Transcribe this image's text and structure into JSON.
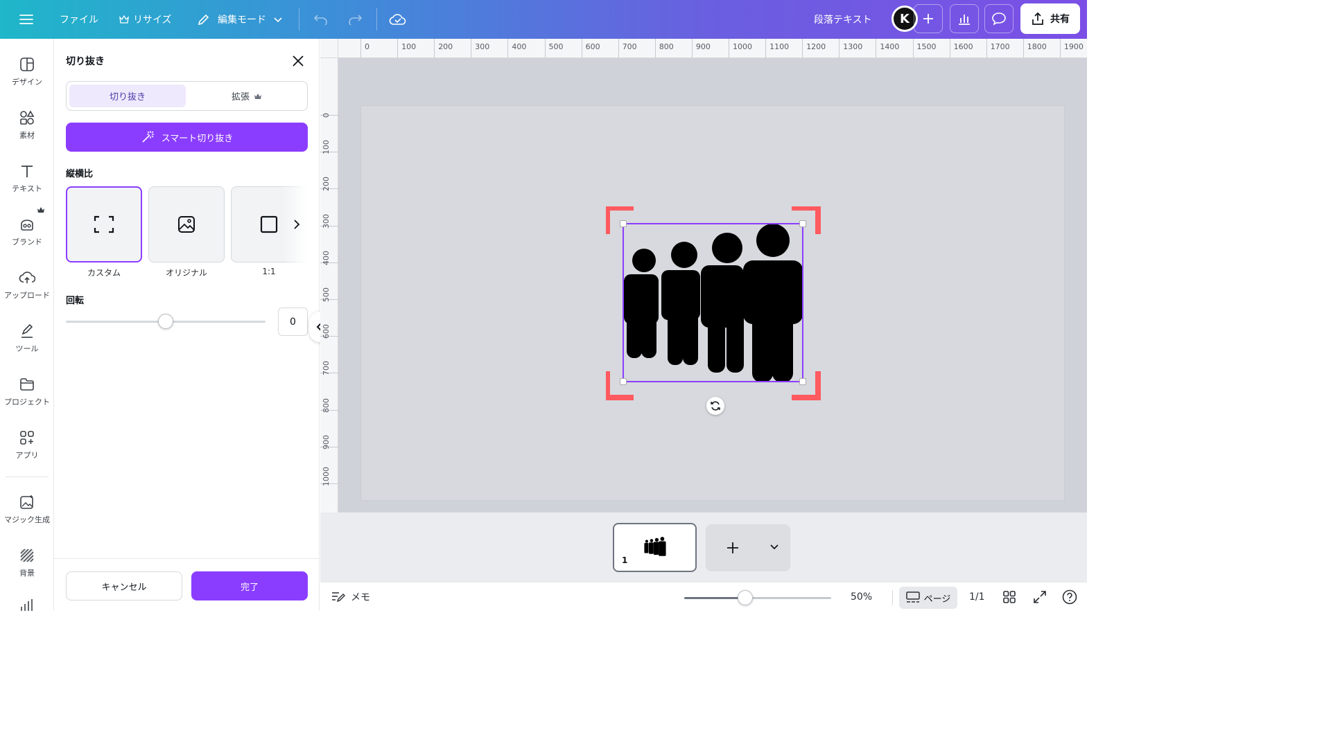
{
  "topbar": {
    "file_label": "ファイル",
    "resize_label": "リサイズ",
    "edit_mode_label": "編集モード",
    "text_label": "段落テキスト",
    "avatar_letter": "K",
    "share_label": "共有"
  },
  "rail": {
    "items": [
      {
        "label": "デザイン",
        "icon": "layout-icon"
      },
      {
        "label": "素材",
        "icon": "shapes-icon"
      },
      {
        "label": "テキスト",
        "icon": "text-icon"
      },
      {
        "label": "ブランド",
        "icon": "brand-icon"
      },
      {
        "label": "アップロード",
        "icon": "upload-cloud-icon"
      },
      {
        "label": "ツール",
        "icon": "pen-tool-icon"
      },
      {
        "label": "プロジェクト",
        "icon": "folder-icon"
      },
      {
        "label": "アプリ",
        "icon": "apps-icon"
      },
      {
        "label": "マジック生成",
        "icon": "magic-image-icon"
      },
      {
        "label": "背景",
        "icon": "background-pattern-icon"
      }
    ]
  },
  "panel": {
    "title": "切り抜き",
    "tab_crop": "切り抜き",
    "tab_expand": "拡張",
    "smart_crop": "スマート切り抜き",
    "aspect_label": "縦横比",
    "ratios": [
      {
        "label": "カスタム",
        "selected": true
      },
      {
        "label": "オリジナル",
        "selected": false
      },
      {
        "label": "1:1",
        "selected": false
      }
    ],
    "rotation_label": "回転",
    "rotation_value": "0",
    "cancel": "キャンセル",
    "done": "完了"
  },
  "ruler": {
    "top": [
      "0",
      "100",
      "200",
      "300",
      "400",
      "500",
      "600",
      "700",
      "800",
      "900",
      "1000",
      "1100",
      "1200",
      "1300",
      "1400",
      "1500",
      "1600",
      "1700",
      "1800",
      "1900"
    ],
    "left": [
      "0",
      "100",
      "200",
      "300",
      "400",
      "500",
      "600",
      "700",
      "800",
      "900",
      "1000"
    ]
  },
  "pages": {
    "current_page_number": "1"
  },
  "bottombar": {
    "notes": "メモ",
    "zoom": "50%",
    "page_view": "ページ",
    "page_count": "1/1"
  },
  "colors": {
    "accent": "#8b3dff",
    "crop_corner": "#ff5a5f"
  }
}
